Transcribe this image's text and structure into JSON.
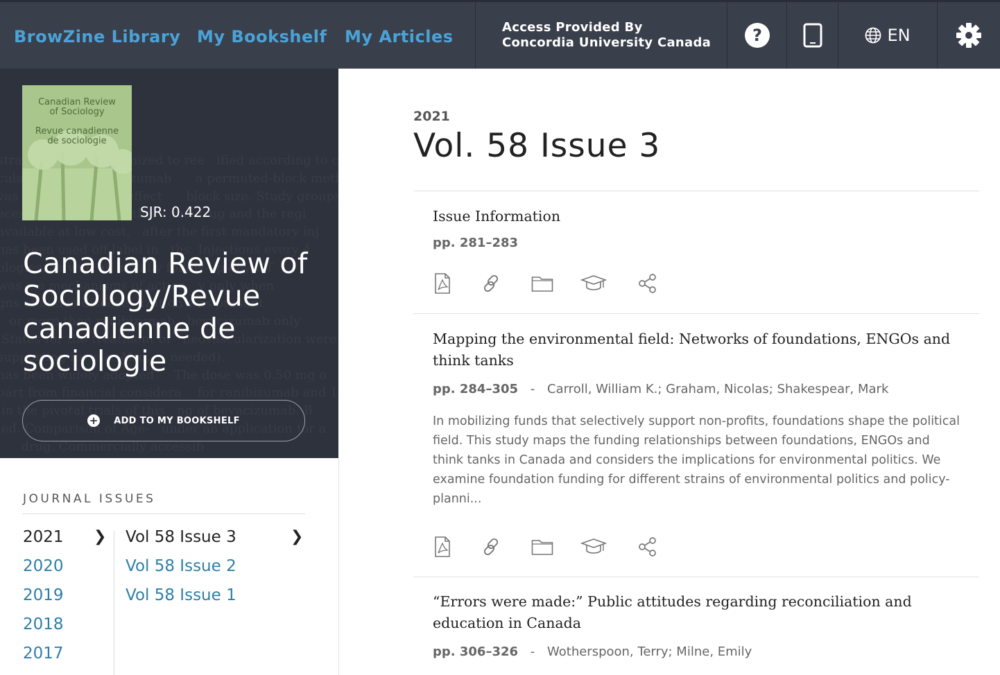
{
  "nav": {
    "browzine_library": "BrowZine Library",
    "my_bookshelf": "My Bookshelf",
    "my_articles": "My Articles",
    "access_line1": "Access Provided By",
    "access_line2": "Concordia University Canada",
    "language": "EN",
    "icons": [
      "help-icon",
      "tablet-icon",
      "globe-icon",
      "gear-icon"
    ]
  },
  "journal": {
    "cover_title": "Canadian Review\nof Sociology",
    "cover_subtitle": "Revue canadienne\nde sociologie",
    "sjr": "SJR: 0.422",
    "title": "Canadian Review of Sociology/Revue canadienne de sociologie",
    "add_bookshelf": "ADD TO MY BOOKSHELF",
    "cover_color": "#a7c489"
  },
  "issues_nav": {
    "heading": "JOURNAL ISSUES",
    "years": [
      "2021",
      "2020",
      "2019",
      "2018",
      "2017"
    ],
    "selected_year": "2021",
    "issues": [
      "Vol 58 Issue 3",
      "Vol 58 Issue 2",
      "Vol 58 Issue 1"
    ],
    "selected_issue": "Vol 58 Issue 3"
  },
  "issue": {
    "year": "2021",
    "title": "Vol. 58 Issue 3"
  },
  "articles": [
    {
      "title": "Issue Information",
      "pages": "pp. 281–283",
      "authors": "",
      "abstract": ""
    },
    {
      "title": "Mapping the environmental field: Networks of foundations, ENGOs and think tanks",
      "pages": "pp. 284–305",
      "authors": "Carroll, William K.; Graham, Nicolas; Shakespear, Mark",
      "abstract": "In mobilizing funds that selectively support non-profits, foundations shape the political field. This study maps the funding relationships between foundations, ENGOs and think tanks in Canada and considers the implications for environmental politics. We examine foundation funding for different strains of environmental politics and policy-planni..."
    },
    {
      "title": "“Errors were made:” Public attitudes regarding reconciliation and education in Canada",
      "pages": "pp. 306–326",
      "authors": "Wotherspoon, Terry; Milne, Emily",
      "abstract": ""
    }
  ],
  "article_actions": [
    "pdf-icon",
    "link-icon",
    "folder-icon",
    "mortarboard-icon",
    "share-icon"
  ],
  "separator": "-",
  "colors": {
    "accent": "#4aa3d8",
    "link": "#2e7fa8",
    "topbar": "#3a3f4c",
    "hero": "#2e323d"
  }
}
